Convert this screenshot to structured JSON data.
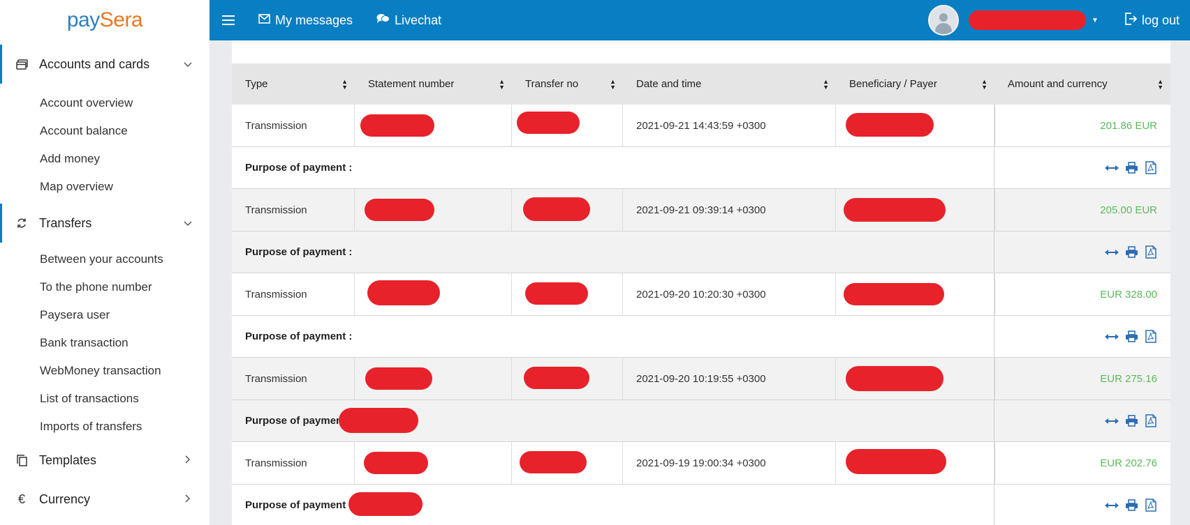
{
  "brand": {
    "logo_left": "pay",
    "logo_right": "Sera"
  },
  "topbar": {
    "my_messages": "My messages",
    "livechat": "Livechat",
    "logout": "log out"
  },
  "sidebar": {
    "sections": [
      {
        "label": "Accounts and cards",
        "expanded": true,
        "items": [
          "Account overview",
          "Account balance",
          "Add money",
          "Map overview"
        ]
      },
      {
        "label": "Transfers",
        "expanded": true,
        "items": [
          "Between your accounts",
          "To the phone number",
          "Paysera user",
          "Bank transaction",
          "WebMoney transaction",
          "List of transactions",
          "Imports of transfers"
        ]
      },
      {
        "label": "Templates",
        "expanded": false
      },
      {
        "label": "Currency",
        "expanded": false
      }
    ]
  },
  "table": {
    "headers": [
      "Type",
      "Statement number",
      "Transfer no",
      "Date and time",
      "Beneficiary / Payer",
      "Amount and currency"
    ],
    "purpose_label": "Purpose of payment :",
    "purpose_label_short": "Purpose of payment",
    "rows": [
      {
        "type": "Transmission",
        "datetime": "2021-09-21 14:43:59 +0300",
        "amount": "201.86 EUR"
      },
      {
        "type": "Transmission",
        "datetime": "2021-09-21 09:39:14 +0300",
        "amount": "205.00 EUR"
      },
      {
        "type": "Transmission",
        "datetime": "2021-09-20 10:20:30 +0300",
        "amount": "EUR 328.00"
      },
      {
        "type": "Transmission",
        "datetime": "2021-09-20 10:19:55 +0300",
        "amount": "EUR 275.16"
      },
      {
        "type": "Transmission",
        "datetime": "2021-09-19 19:00:34 +0300",
        "amount": "EUR 202.76"
      }
    ]
  },
  "colors": {
    "primary": "#0a7ec2",
    "amount": "#5cb85c",
    "redaction": "#e8222a",
    "brand_orange": "#e87722"
  }
}
